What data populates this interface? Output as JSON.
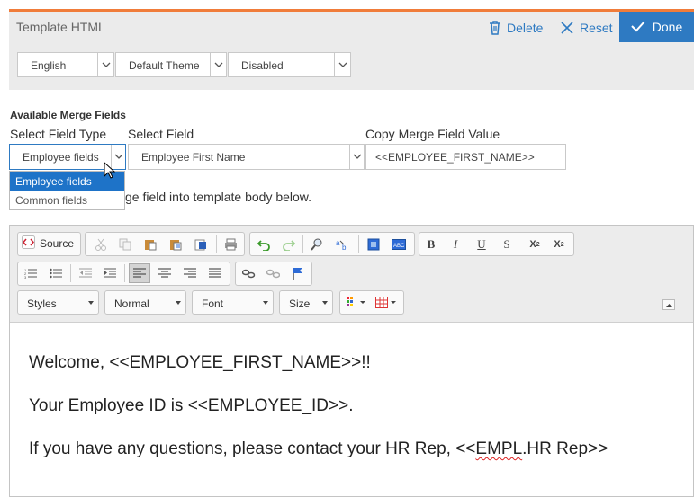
{
  "header": {
    "title": "Template HTML",
    "delete_label": "Delete",
    "reset_label": "Reset",
    "done_label": "Done",
    "selects": {
      "language": "English",
      "theme": "Default Theme",
      "status": "Disabled"
    }
  },
  "merge": {
    "title": "Available Merge Fields",
    "field_type_label": "Select Field Type",
    "field_label": "Select Field",
    "copy_label": "Copy Merge Field Value",
    "field_type_value": "Employee fields",
    "field_value": "Employee First Name",
    "copy_value": "<<EMPLOYEE_FIRST_NAME>>",
    "dropdown_options": [
      "Employee fields",
      "Common fields"
    ],
    "hint": "ge field into template body below."
  },
  "toolbar": {
    "source_label": "Source",
    "bold": "B",
    "italic": "I",
    "underline": "U",
    "strike": "S",
    "styles": "Styles",
    "format": "Normal",
    "font": "Font",
    "size": "Size"
  },
  "body": {
    "line1": "Welcome, <<EMPLOYEE_FIRST_NAME>>!!",
    "line2": "Your Employee ID is <<EMPLOYEE_ID>>.",
    "line3_pre": "If you have any questions, please contact your HR Rep, <<",
    "line3_err": "EMPL",
    "line3_post": ".HR Rep>>"
  },
  "colors": {
    "accent": "#2e7ac2",
    "header_stripe": "#f07c3a",
    "selected": "#1e73c8"
  }
}
